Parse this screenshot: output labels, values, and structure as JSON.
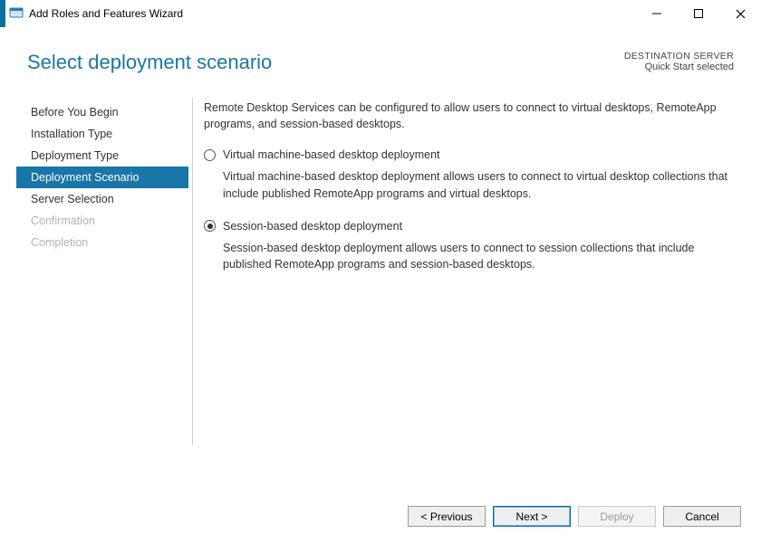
{
  "window": {
    "title": "Add Roles and Features Wizard"
  },
  "header": {
    "page_title": "Select deployment scenario",
    "destination_label": "DESTINATION SERVER",
    "destination_value": "Quick Start selected"
  },
  "nav": {
    "items": [
      {
        "label": "Before You Begin",
        "state": "normal"
      },
      {
        "label": "Installation Type",
        "state": "normal"
      },
      {
        "label": "Deployment Type",
        "state": "normal"
      },
      {
        "label": "Deployment Scenario",
        "state": "active"
      },
      {
        "label": "Server Selection",
        "state": "normal"
      },
      {
        "label": "Confirmation",
        "state": "disabled"
      },
      {
        "label": "Completion",
        "state": "disabled"
      }
    ]
  },
  "content": {
    "intro": "Remote Desktop Services can be configured to allow users to connect to virtual desktops, RemoteApp programs, and session-based desktops.",
    "options": [
      {
        "key": "vm-based",
        "label": "Virtual machine-based desktop deployment",
        "description": "Virtual machine-based desktop deployment allows users to connect to virtual desktop collections that include published RemoteApp programs and virtual desktops.",
        "selected": false
      },
      {
        "key": "session-based",
        "label": "Session-based desktop deployment",
        "description": "Session-based desktop deployment allows users to connect to session collections that include published RemoteApp programs and session-based desktops.",
        "selected": true
      }
    ]
  },
  "footer": {
    "previous": "< Previous",
    "next": "Next >",
    "deploy": "Deploy",
    "cancel": "Cancel"
  }
}
